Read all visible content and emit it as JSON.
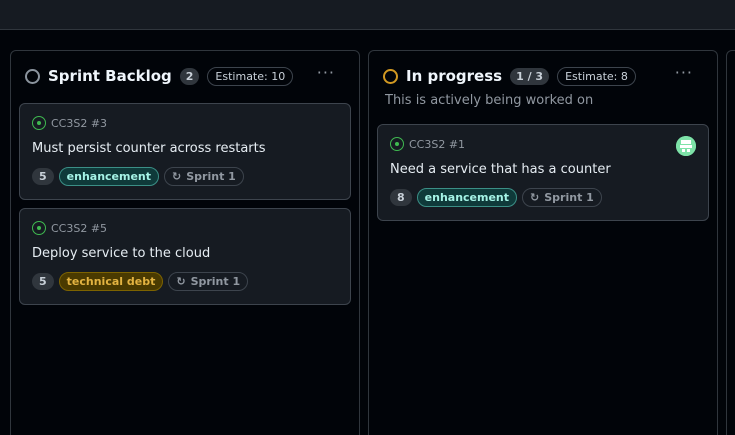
{
  "colors": {
    "backlog_status": "#8b949e",
    "progress_status": "#d29922",
    "open_issue": "#3fb950",
    "enhancement": "#a5f3e6",
    "technical_debt": "#e3b341"
  },
  "columns": [
    {
      "title": "Sprint Backlog",
      "count": "2",
      "estimate": "Estimate: 10",
      "menu": "···",
      "cards": [
        {
          "ref": "CC3S2 #3",
          "title": "Must persist counter across restarts",
          "points": "5",
          "label": "enhancement",
          "iteration": "Sprint 1",
          "icon": "open-issue-icon"
        },
        {
          "ref": "CC3S2 #5",
          "title": "Deploy service to the cloud",
          "points": "5",
          "label": "technical debt",
          "iteration": "Sprint 1",
          "icon": "open-issue-icon"
        }
      ]
    },
    {
      "title": "In progress",
      "count": "1 / 3",
      "estimate": "Estimate: 8",
      "menu": "···",
      "description": "This is actively being worked on",
      "cards": [
        {
          "ref": "CC3S2 #1",
          "title": "Need a service that has a counter",
          "points": "8",
          "label": "enhancement",
          "iteration": "Sprint 1",
          "icon": "open-issue-icon",
          "assignee_avatar": "avatar-icon"
        }
      ]
    }
  ]
}
